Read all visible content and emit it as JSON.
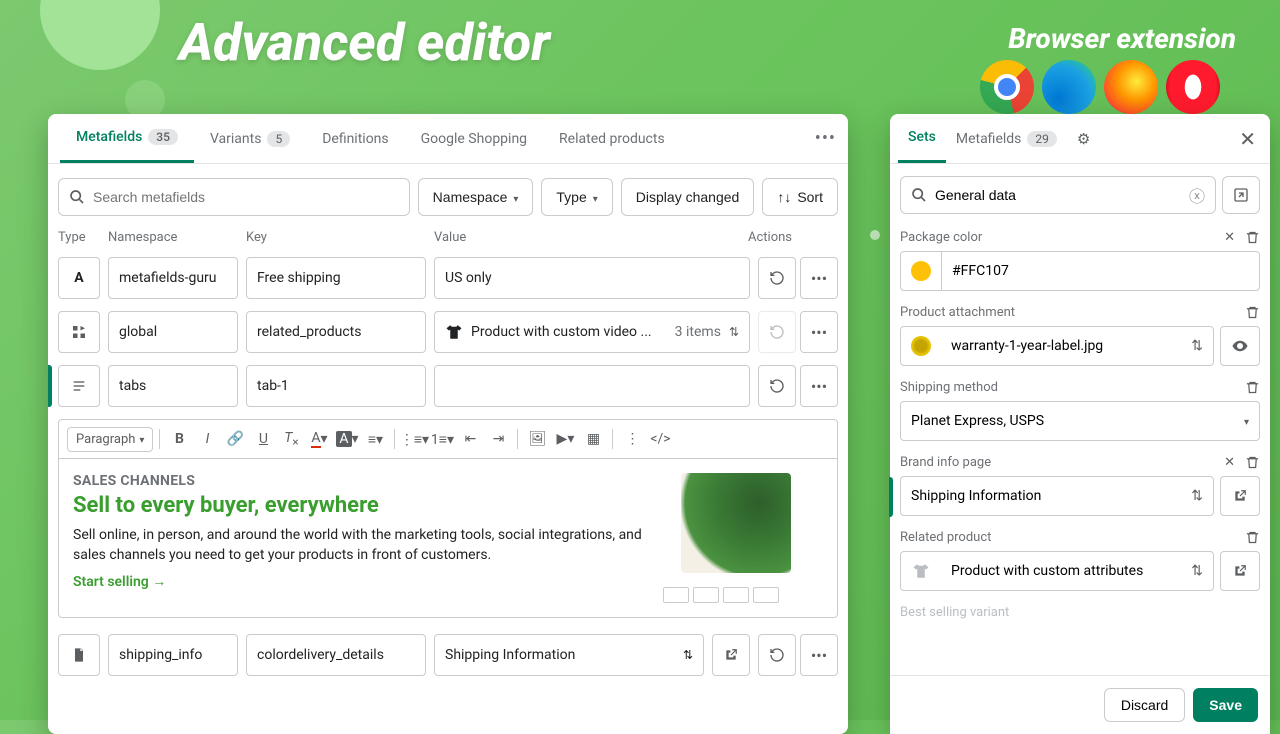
{
  "hero": {
    "title": "Advanced editor",
    "ext_title": "Browser extension"
  },
  "tabs": {
    "metafields": "Metafields",
    "metafields_count": "35",
    "variants": "Variants",
    "variants_count": "5",
    "definitions": "Definitions",
    "google": "Google Shopping",
    "related": "Related products"
  },
  "filters": {
    "search_placeholder": "Search metafields",
    "namespace": "Namespace",
    "type": "Type",
    "display_changed": "Display changed",
    "sort": "Sort"
  },
  "headers": {
    "type": "Type",
    "namespace": "Namespace",
    "key": "Key",
    "value": "Value",
    "actions": "Actions"
  },
  "rows": {
    "r1": {
      "ns": "metafields-guru",
      "key": "Free shipping",
      "val": "US only"
    },
    "r2": {
      "ns": "global",
      "key": "related_products",
      "val": "Product with custom video ...",
      "count": "3 items"
    },
    "r3": {
      "ns": "tabs",
      "key": "tab-1"
    },
    "r4": {
      "ns": "shipping_info",
      "key": "colordelivery_details",
      "val": "Shipping Information"
    }
  },
  "rte": {
    "paragraph": "Paragraph",
    "h1": "SALES CHANNELS",
    "h2": "Sell to every buyer, everywhere",
    "body": "Sell online, in person, and around the world with the marketing tools, social integrations, and sales channels you need to get your products in front of customers.",
    "cta": "Start selling →"
  },
  "ext_tabs": {
    "sets": "Sets",
    "meta": "Metafields",
    "meta_count": "29"
  },
  "ext_search": {
    "value": "General data"
  },
  "fields": {
    "package_color": {
      "label": "Package color",
      "value": "#FFC107"
    },
    "attachment": {
      "label": "Product attachment",
      "value": "warranty-1-year-label.jpg"
    },
    "shipping": {
      "label": "Shipping method",
      "value": "Planet Express, USPS"
    },
    "brand": {
      "label": "Brand info page",
      "value": "Shipping Information"
    },
    "related": {
      "label": "Related product",
      "value": "Product with custom attributes"
    },
    "best": {
      "label": "Best selling variant"
    }
  },
  "footer": {
    "discard": "Discard",
    "save": "Save"
  }
}
